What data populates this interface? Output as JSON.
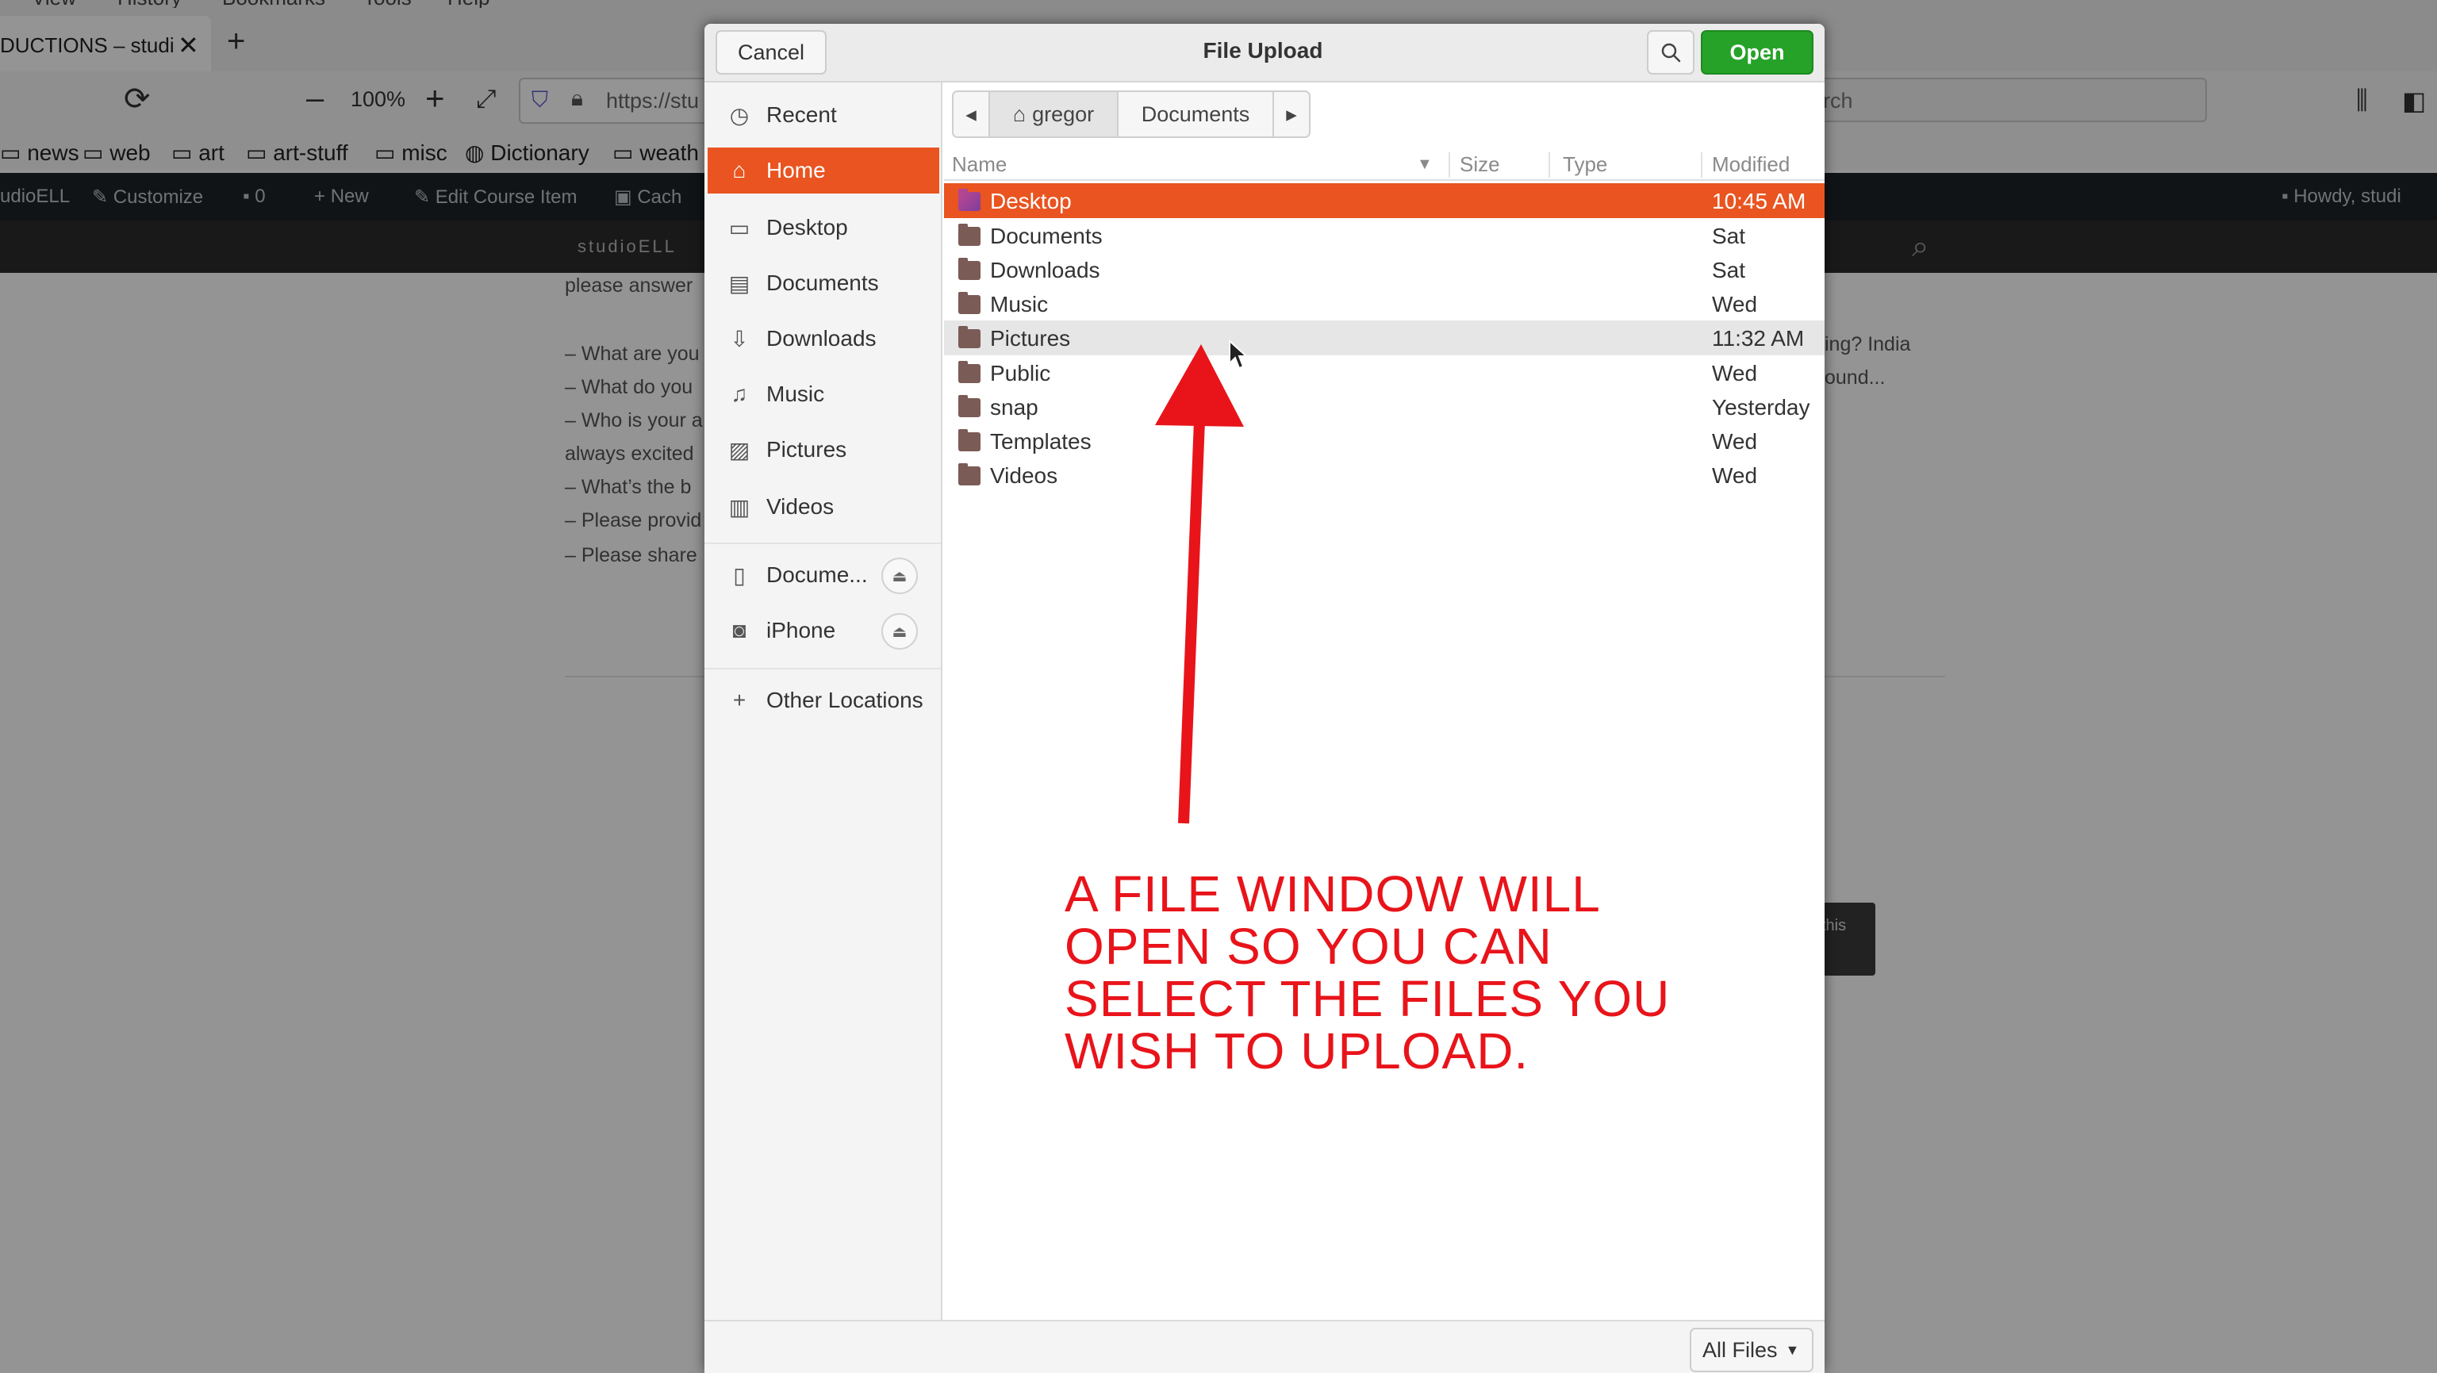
{
  "browser": {
    "menu_items": [
      "View",
      "History",
      "Bookmarks",
      "Tools",
      "Help"
    ],
    "tab_title": "DUCTIONS – studi",
    "tab_close": "✕",
    "new_tab": "+",
    "zoom_minus": "–",
    "zoom_level": "100%",
    "zoom_plus": "+",
    "url": "https://stu",
    "search_placeholder": "rch",
    "bookmarks": [
      "news",
      "web",
      "art",
      "art-stuff",
      "misc",
      "Dictionary",
      "weath"
    ],
    "admin_bar": [
      "udioELL",
      "Customize",
      "0",
      "New",
      "Edit Course Item",
      "Cach",
      "Howdy, studi"
    ],
    "site_name": "studioELL",
    "content_lines": [
      "please answer",
      "– What are you",
      "– What do you",
      "– Who is your a",
      "always excited",
      "– What’s the b",
      "– Please provid",
      "– Please share"
    ],
    "content_right_lines": [
      "ing? India",
      "ound..."
    ],
    "content_button_text": "this"
  },
  "dialog": {
    "title": "File Upload",
    "cancel_label": "Cancel",
    "open_label": "Open",
    "search_icon": "magnifier-icon",
    "places": [
      {
        "label": "Recent",
        "icon": "clock-icon"
      },
      {
        "label": "Home",
        "icon": "home-icon",
        "selected": true
      },
      {
        "label": "Desktop",
        "icon": "desktop-icon"
      },
      {
        "label": "Documents",
        "icon": "document-icon"
      },
      {
        "label": "Downloads",
        "icon": "download-icon"
      },
      {
        "label": "Music",
        "icon": "music-icon"
      },
      {
        "label": "Pictures",
        "icon": "picture-icon"
      },
      {
        "label": "Videos",
        "icon": "film-icon"
      }
    ],
    "devices": [
      {
        "label": "Docume...",
        "icon": "phone-icon",
        "eject": "⏏"
      },
      {
        "label": "iPhone",
        "icon": "camera-icon",
        "eject": "⏏"
      }
    ],
    "other_locations": {
      "label": "Other Locations",
      "icon": "plus-icon"
    },
    "path": {
      "home": "gregor",
      "current": "Documents"
    },
    "columns": {
      "name": "Name",
      "size": "Size",
      "type": "Type",
      "modified": "Modified"
    },
    "files": [
      {
        "name": "Desktop",
        "modified": "10:45 AM",
        "state": "selected"
      },
      {
        "name": "Documents",
        "modified": "Sat"
      },
      {
        "name": "Downloads",
        "modified": "Sat"
      },
      {
        "name": "Music",
        "modified": "Wed"
      },
      {
        "name": "Pictures",
        "modified": "11:32 AM",
        "state": "hover"
      },
      {
        "name": "Public",
        "modified": "Wed"
      },
      {
        "name": "snap",
        "modified": "Yesterday"
      },
      {
        "name": "Templates",
        "modified": "Wed"
      },
      {
        "name": "Videos",
        "modified": "Wed"
      }
    ],
    "filter_label": "All Files"
  },
  "annotation": {
    "lines": [
      "A FILE WINDOW WILL",
      "OPEN SO YOU CAN",
      "SELECT THE FILES YOU",
      "WISH TO UPLOAD."
    ],
    "color": "#e8141a"
  },
  "colors": {
    "accent": "#e95420",
    "open_button": "#26a228"
  }
}
